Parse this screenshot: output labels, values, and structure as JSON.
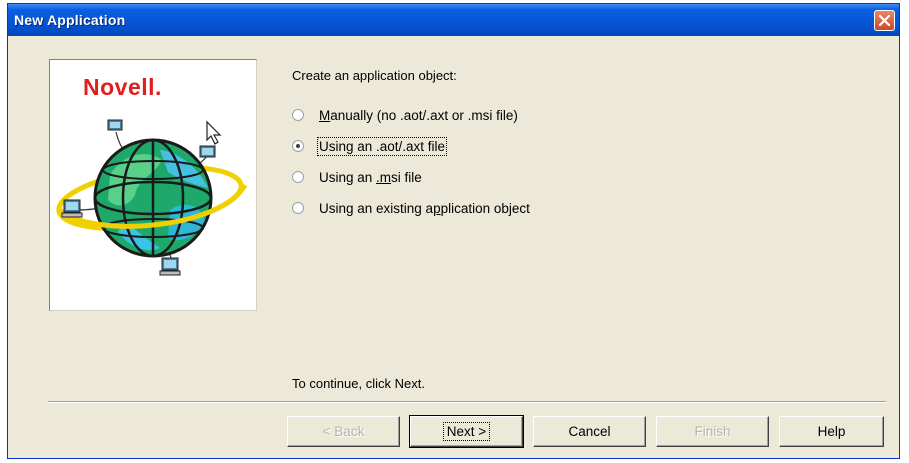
{
  "window": {
    "title": "New Application"
  },
  "branding": {
    "logo_text": "Novell."
  },
  "content": {
    "prompt": "Create an application object:",
    "options": [
      {
        "label_pre": "",
        "mnemonic": "M",
        "label_post": "anually (no .aot/.axt or .msi file)",
        "checked": false
      },
      {
        "label_pre": "Using an .aot/.axt file",
        "mnemonic": "",
        "label_post": "",
        "checked": true
      },
      {
        "label_pre": "Using an ",
        "mnemonic": ".m",
        "label_post": "si file",
        "checked": false
      },
      {
        "label_pre": "Using an existing a",
        "mnemonic": "p",
        "label_post": "plication object",
        "checked": false
      }
    ],
    "continue_text": "To continue, click Next."
  },
  "buttons": {
    "back": "< Back",
    "next": "Next >",
    "cancel": "Cancel",
    "finish": "Finish",
    "help": "Help"
  },
  "colors": {
    "titlebar": "#0555d6",
    "dialog_bg": "#ece9d8",
    "logo_red": "#e02020"
  }
}
